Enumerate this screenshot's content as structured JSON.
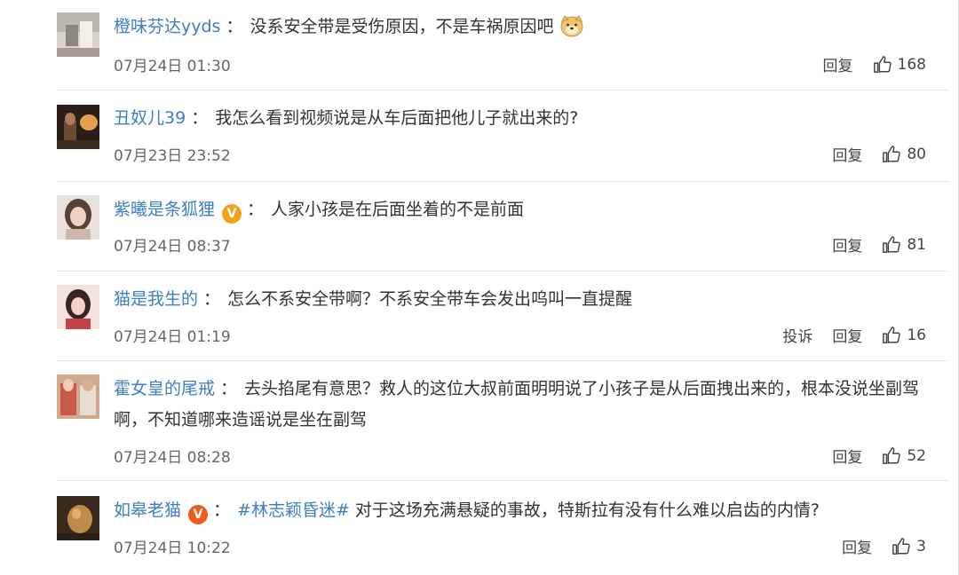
{
  "comments": [
    {
      "user": "橙味芬达yyds",
      "colon": "：",
      "text": "没系安全带是受伤原因，不是车祸原因吧",
      "emoji": "dog-face-emoji",
      "time": "07月24日 01:30",
      "reply": "回复",
      "likes": "168"
    },
    {
      "user": "丑奴儿39",
      "colon": "：",
      "text": "我怎么看到视频说是从车后面把他儿子就出来的?",
      "time": "07月23日 23:52",
      "reply": "回复",
      "likes": "80"
    },
    {
      "user": "紫曦是条狐狸",
      "badge": "V",
      "colon": "：",
      "text": "人家小孩是在后面坐着的不是前面",
      "time": "07月24日 08:37",
      "reply": "回复",
      "likes": "81"
    },
    {
      "user": "猫是我生的",
      "colon": "：",
      "text": "怎么不系安全带啊？不系安全带车会发出呜叫一直提醒",
      "time": "07月24日 01:19",
      "report": "投诉",
      "reply": "回复",
      "likes": "16"
    },
    {
      "user": "霍女皇的尾戒",
      "colon": "：",
      "text": "去头掐尾有意思？救人的这位大叔前面明明说了小孩子是从后面拽出来的，根本没说坐副驾",
      "text2": "啊，不知道哪来造谣说是坐在副驾",
      "time": "07月24日 08:28",
      "reply": "回复",
      "likes": "52"
    },
    {
      "user": "如皋老猫",
      "badge": "V",
      "colon": "：",
      "topic": "#林志颖昏迷#",
      "text": "对于这场充满悬疑的事故，特斯拉有没有什么难以启齿的内情?",
      "time": "07月24日 10:22",
      "reply": "回复",
      "likes": "3"
    }
  ],
  "colors": {
    "username": "#3c7fc1",
    "badge": "#f0a21a",
    "divider": "#e6e6e6"
  }
}
